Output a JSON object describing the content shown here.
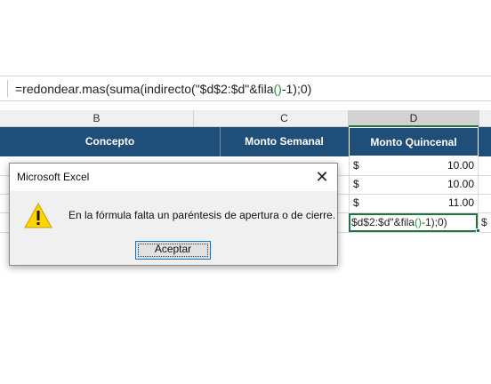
{
  "formula_bar": {
    "formula_head": "=redondear.mas(suma(indirecto(\"$d$2:$d\"&fila",
    "paren_open": "(",
    "paren_close": ")",
    "formula_tail": "-1);0)"
  },
  "columns": [
    {
      "id": "col-b",
      "label": "B"
    },
    {
      "id": "col-c",
      "label": "C"
    },
    {
      "id": "col-d",
      "label": "D"
    }
  ],
  "table_header": {
    "concepto": "Concepto",
    "monto_semanal": "Monto Semanal",
    "monto_quincenal": "Monto Quincenal"
  },
  "rows": [
    {
      "currency": "$",
      "quincenal": "10.00"
    },
    {
      "currency": "$",
      "quincenal": "10.00"
    },
    {
      "currency": "$",
      "quincenal": "11.00"
    }
  ],
  "edit_cell": {
    "head": "$d$2:$d\"&fila",
    "paren_open": "(",
    "paren_close": ")",
    "tail": "-1);0)"
  },
  "col_e_partial": "$",
  "dialog": {
    "title": "Microsoft Excel",
    "close_glyph": "✕",
    "message": "En la fórmula falta un paréntesis de apertura o de cierre.",
    "ok_label": "Aceptar",
    "icon": "warning-icon"
  },
  "colors": {
    "header_blue": "#1f4e79",
    "excel_green": "#217346",
    "paren_green": "#1f8f3a",
    "warning_yellow": "#ffd400"
  }
}
